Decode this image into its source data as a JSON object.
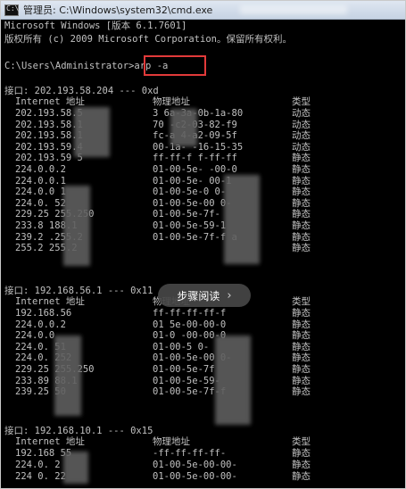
{
  "window": {
    "title": "管理员: C:\\Windows\\system32\\cmd.exe",
    "icon": "cmd-icon"
  },
  "header": {
    "line1": "Microsoft Windows [版本 6.1.7601]",
    "line2": "版权所有 (c) 2009 Microsoft Corporation。保留所有权利。"
  },
  "prompt": {
    "path": "C:\\Users\\Administrator>",
    "command": "arp -a"
  },
  "interfaces": [
    {
      "header": "接口: 202.193.58.204 --- 0xd",
      "columns": [
        "Internet 地址",
        "物理地址",
        "类型"
      ],
      "rows": [
        [
          "202.193.58.5",
          "3 6a-3a-0b-1a-80",
          "动态"
        ],
        [
          "202.193.58.1",
          "70 -c2-03-82-f9",
          "动态"
        ],
        [
          "202.193.58.1",
          "fc-a 4-a2-09-5f",
          "动态"
        ],
        [
          "202.193.59.4",
          "00-1a- -16-15-35",
          "动态"
        ],
        [
          "202.193.59 5",
          "ff-ff-f f-ff-ff",
          "静态"
        ],
        [
          "224.0.0.2",
          "01-00-5e- -00-0",
          "静态"
        ],
        [
          "224.0.0.1",
          "01-00-5e- 00-1",
          "静态"
        ],
        [
          "224.0.0 1",
          "01-00-5e-0 0-",
          "静态"
        ],
        [
          "224.0. 52",
          "01-00-5e-00 0-",
          "静态"
        ],
        [
          "229.25 255.250",
          "01-00-5e-7f-",
          "静态"
        ],
        [
          "233.8 188.1",
          "01-00-5e-59-1",
          "静态"
        ],
        [
          "239.2 .255.2",
          "01-00-5e-7f-f a",
          "静态"
        ],
        [
          "255.2 255.2",
          "",
          "静态"
        ]
      ]
    },
    {
      "header": "接口: 192.168.56.1 --- 0x11",
      "columns": [
        "Internet 地址",
        "物理地址",
        "类型"
      ],
      "rows": [
        [
          "192.168.56",
          "ff-ff-ff-ff-f",
          "静态"
        ],
        [
          "224.0.0.2",
          "01 5e-00-00-0",
          "静态"
        ],
        [
          "224.0.0",
          "01-0 -00-00-0",
          "静态"
        ],
        [
          "224.0. 51",
          "01-00-5 0-",
          "静态"
        ],
        [
          "224.0. 252",
          "01-00-5e-00 0-",
          "静态"
        ],
        [
          "229.25 255.250",
          "01-00-5e-7f",
          "静态"
        ],
        [
          "233.89 88.1",
          "01-00-5e-59-",
          "静态"
        ],
        [
          "239.25 50",
          "01-00-5e-7f-f",
          "静态"
        ]
      ]
    },
    {
      "header": "接口: 192.168.10.1 --- 0x15",
      "columns": [
        "Internet 地址",
        "物理地址",
        "类型"
      ],
      "rows": [
        [
          "192.168 55",
          "-ff-ff-ff-ff-",
          "静态"
        ],
        [
          "224.0. 2",
          "01-00-5e-00-00-",
          "静态"
        ],
        [
          "224 0. 22",
          "01-00-5e-00-00-",
          "静态"
        ]
      ]
    }
  ],
  "overlay": {
    "label": "步骤阅读",
    "icon": "chevron-right-icon"
  },
  "colors": {
    "console_bg": "#000000",
    "console_text": "#c0c0c0",
    "highlight": "#e23a3a"
  }
}
